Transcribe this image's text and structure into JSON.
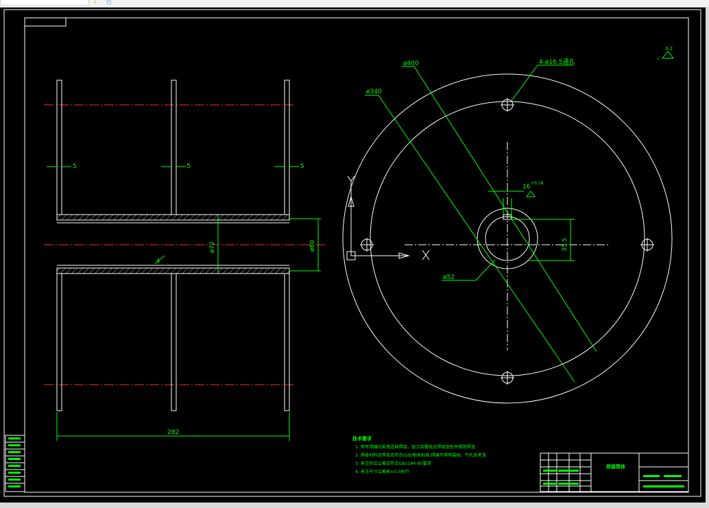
{
  "drawing": {
    "left_view": {
      "wall_thickness_labels": [
        "5",
        "5",
        "5"
      ],
      "overall_length": "282",
      "bore_diameter": "ø72",
      "outer_diameter": "ø80",
      "side_note": "4"
    },
    "right_view": {
      "dia_400": "ø400",
      "dia_340": "ø340",
      "hole_callout": "4-ø16.5通孔",
      "keyway_width": "16",
      "keyway_tol": "+0.18",
      "keyway_depth": "35.5",
      "bore_dia": "ø52",
      "roughness": "3.2"
    },
    "tech_requirements": {
      "heading": "技术要求",
      "items": [
        "1. 所有焊缝均采用连续焊接，加工前需校正焊接变形并清除焊渣",
        "2. 焊接材料及焊条应符合(GB)相关标准,焊缝不得有裂纹、气孔及夹渣",
        "3. 未注形位公差应符合GB1184-80要求",
        "4. 未注尺寸公差按±0.5执行"
      ]
    },
    "title_block": {
      "part_name": "焊接筒体"
    }
  },
  "colors": {
    "background": "#000000",
    "outline": "#ffffff",
    "dimension": "#00ff00",
    "centerline": "#ff2a2a"
  }
}
